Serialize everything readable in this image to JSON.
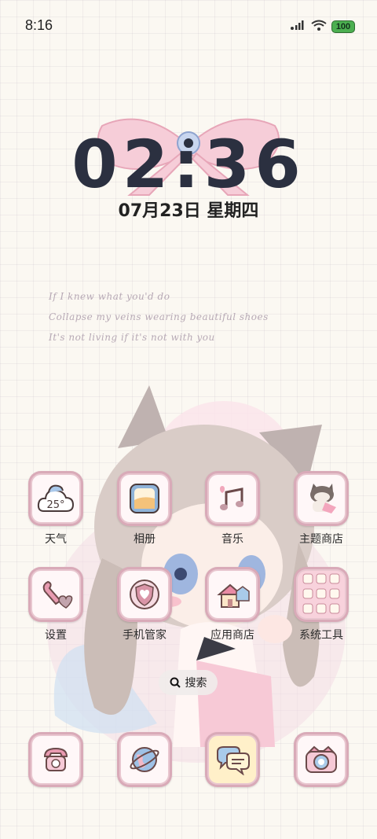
{
  "status_bar": {
    "time": "8:16",
    "battery": "100"
  },
  "lockclock": {
    "time": "02:36",
    "date": "07月23日 星期四"
  },
  "quote": {
    "line1": "If I knew what you'd do",
    "line2": "Collapse my veins wearing beautiful shoes",
    "line3": "It's not living if it's not with you"
  },
  "apps": {
    "weather": "天气",
    "weather_icon_text": "25°",
    "gallery": "相册",
    "music": "音乐",
    "theme_store": "主题商店",
    "settings": "设置",
    "phone_manager": "手机管家",
    "app_store": "应用商店",
    "system_tools": "系统工具"
  },
  "search": {
    "label": "搜索"
  },
  "colors": {
    "accent_pink": "#d9aab8",
    "clock_text": "#2b3040",
    "background": "#fbf8f2"
  }
}
